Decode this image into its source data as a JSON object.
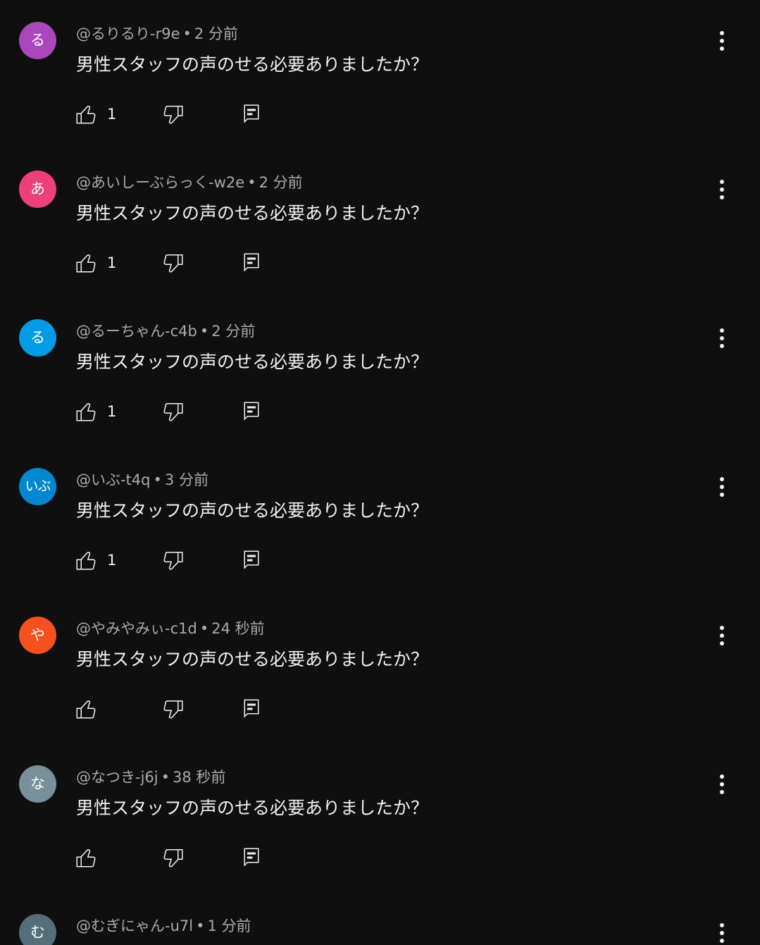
{
  "colors": {
    "background": "#0f0f0f",
    "text_primary": "#f1f1f1",
    "text_secondary": "#aaaaaa"
  },
  "icons": {
    "like": "thumb-up-icon",
    "dislike": "thumb-down-icon",
    "reply": "comment-icon",
    "more": "more-vertical-icon"
  },
  "comments": [
    {
      "avatar_text": "る",
      "avatar_color": "#ab47bc",
      "handle": "@るりるり-r9e",
      "time": "2 分前",
      "text": "男性スタッフの声のせる必要ありましたか？",
      "likes": "1"
    },
    {
      "avatar_text": "あ",
      "avatar_color": "#ec407a",
      "handle": "@あいしーぶらっく-w2e",
      "time": "2 分前",
      "text": "男性スタッフの声のせる必要ありましたか？",
      "likes": "1"
    },
    {
      "avatar_text": "る",
      "avatar_color": "#039be5",
      "handle": "@るーちゃん-c4b",
      "time": "2 分前",
      "text": "男性スタッフの声のせる必要ありましたか？",
      "likes": "1"
    },
    {
      "avatar_text": "いぶ",
      "avatar_color": "#0288d1",
      "handle": "@いぶ-t4q",
      "time": "3 分前",
      "text": "男性スタッフの声のせる必要ありましたか？",
      "likes": "1"
    },
    {
      "avatar_text": "や",
      "avatar_color": "#f4511e",
      "handle": "@やみやみぃ-c1d",
      "time": "24 秒前",
      "text": "男性スタッフの声のせる必要ありましたか？",
      "likes": ""
    },
    {
      "avatar_text": "な",
      "avatar_color": "#78909c",
      "handle": "@なつき-j6j",
      "time": "38 秒前",
      "text": "男性スタッフの声のせる必要ありましたか？",
      "likes": ""
    },
    {
      "avatar_text": "む",
      "avatar_color": "#546e7a",
      "handle": "@むぎにゃん-u7l",
      "time": "1 分前",
      "text": "",
      "likes": ""
    }
  ]
}
